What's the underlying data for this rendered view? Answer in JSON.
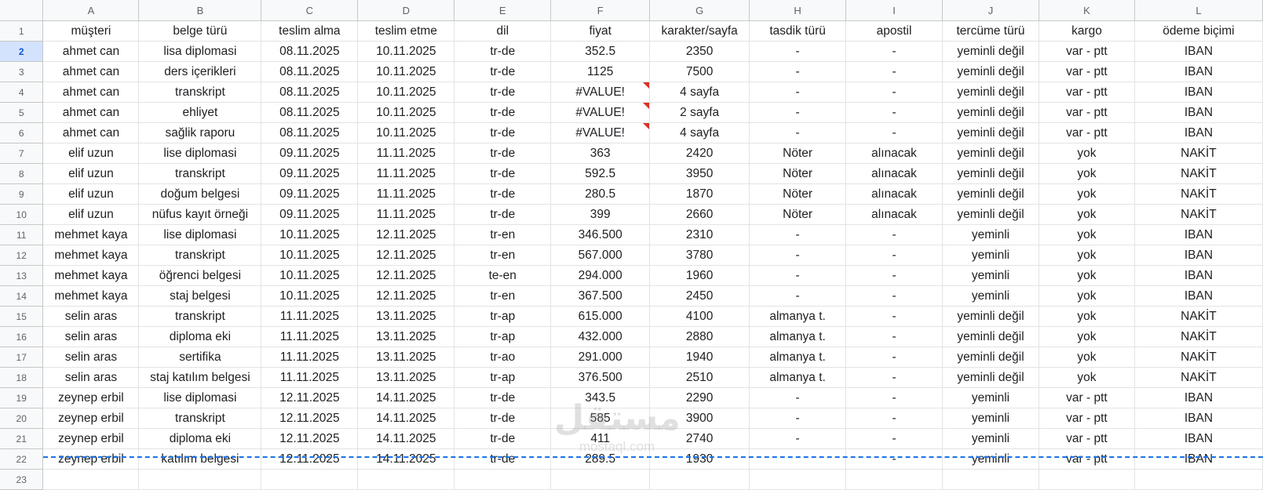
{
  "columns": [
    "A",
    "B",
    "C",
    "D",
    "E",
    "F",
    "G",
    "H",
    "I",
    "J",
    "K",
    "L"
  ],
  "rows": [
    {
      "n": "1",
      "cells": [
        "müşteri",
        "belge türü",
        "teslim alma",
        "teslim etme",
        "dil",
        "fiyat",
        "karakter/sayfa",
        "tasdik türü",
        "apostil",
        "tercüme türü",
        "kargo",
        "ödeme biçimi"
      ]
    },
    {
      "n": "2",
      "cells": [
        "ahmet can",
        "lisa diplomasi",
        "08.11.2025",
        "10.11.2025",
        "tr-de",
        "352.5",
        "2350",
        "-",
        "-",
        "yeminli değil",
        "var - ptt",
        "IBAN"
      ]
    },
    {
      "n": "3",
      "cells": [
        "ahmet can",
        "ders içerikleri",
        "08.11.2025",
        "10.11.2025",
        "tr-de",
        "1125",
        "7500",
        "-",
        "-",
        "yeminli değil",
        "var - ptt",
        "IBAN"
      ]
    },
    {
      "n": "4",
      "cells": [
        "ahmet can",
        "transkript",
        "08.11.2025",
        "10.11.2025",
        "tr-de",
        "#VALUE!",
        "4 sayfa",
        "-",
        "-",
        "yeminli değil",
        "var - ptt",
        "IBAN"
      ]
    },
    {
      "n": "5",
      "cells": [
        "ahmet can",
        "ehliyet",
        "08.11.2025",
        "10.11.2025",
        "tr-de",
        "#VALUE!",
        "2 sayfa",
        "-",
        "-",
        "yeminli değil",
        "var - ptt",
        "IBAN"
      ]
    },
    {
      "n": "6",
      "cells": [
        "ahmet can",
        "sağlik raporu",
        "08.11.2025",
        "10.11.2025",
        "tr-de",
        "#VALUE!",
        "4 sayfa",
        "-",
        "-",
        "yeminli değil",
        "var - ptt",
        "IBAN"
      ]
    },
    {
      "n": "7",
      "cells": [
        "elif uzun",
        "lise diplomasi",
        "09.11.2025",
        "11.11.2025",
        "tr-de",
        "363",
        "2420",
        "Nöter",
        "alınacak",
        "yeminli değil",
        "yok",
        "NAKİT"
      ]
    },
    {
      "n": "8",
      "cells": [
        "elif uzun",
        "transkript",
        "09.11.2025",
        "11.11.2025",
        "tr-de",
        "592.5",
        "3950",
        "Nöter",
        "alınacak",
        "yeminli değil",
        "yok",
        "NAKİT"
      ]
    },
    {
      "n": "9",
      "cells": [
        "elif uzun",
        "doğum belgesi",
        "09.11.2025",
        "11.11.2025",
        "tr-de",
        "280.5",
        "1870",
        "Nöter",
        "alınacak",
        "yeminli değil",
        "yok",
        "NAKİT"
      ]
    },
    {
      "n": "10",
      "cells": [
        "elif uzun",
        "nüfus kayıt örneği",
        "09.11.2025",
        "11.11.2025",
        "tr-de",
        "399",
        "2660",
        "Nöter",
        "alınacak",
        "yeminli değil",
        "yok",
        "NAKİT"
      ]
    },
    {
      "n": "11",
      "cells": [
        "mehmet kaya",
        "lise diplomasi",
        "10.11.2025",
        "12.11.2025",
        "tr-en",
        "346.500",
        "2310",
        "-",
        "-",
        "yeminli",
        "yok",
        "IBAN"
      ]
    },
    {
      "n": "12",
      "cells": [
        "mehmet kaya",
        "transkript",
        "10.11.2025",
        "12.11.2025",
        "tr-en",
        "567.000",
        "3780",
        "-",
        "-",
        "yeminli",
        "yok",
        "IBAN"
      ]
    },
    {
      "n": "13",
      "cells": [
        "mehmet kaya",
        "öğrenci belgesi",
        "10.11.2025",
        "12.11.2025",
        "te-en",
        "294.000",
        "1960",
        "-",
        "-",
        "yeminli",
        "yok",
        "IBAN"
      ]
    },
    {
      "n": "14",
      "cells": [
        "mehmet kaya",
        "staj belgesi",
        "10.11.2025",
        "12.11.2025",
        "tr-en",
        "367.500",
        "2450",
        "-",
        "-",
        "yeminli",
        "yok",
        "IBAN"
      ]
    },
    {
      "n": "15",
      "cells": [
        "selin aras",
        "transkript",
        "11.11.2025",
        "13.11.2025",
        "tr-ap",
        "615.000",
        "4100",
        "almanya t.",
        "-",
        "yeminli değil",
        "yok",
        "NAKİT"
      ]
    },
    {
      "n": "16",
      "cells": [
        "selin aras",
        "diploma eki",
        "11.11.2025",
        "13.11.2025",
        "tr-ap",
        "432.000",
        "2880",
        "almanya t.",
        "-",
        "yeminli değil",
        "yok",
        "NAKİT"
      ]
    },
    {
      "n": "17",
      "cells": [
        "selin aras",
        "sertifika",
        "11.11.2025",
        "13.11.2025",
        "tr-ao",
        "291.000",
        "1940",
        "almanya t.",
        "-",
        "yeminli değil",
        "yok",
        "NAKİT"
      ]
    },
    {
      "n": "18",
      "cells": [
        "selin aras",
        "staj katılım belgesi",
        "11.11.2025",
        "13.11.2025",
        "tr-ap",
        "376.500",
        "2510",
        "almanya t.",
        "-",
        "yeminli değil",
        "yok",
        "NAKİT"
      ]
    },
    {
      "n": "19",
      "cells": [
        "zeynep erbil",
        "lise diplomasi",
        "12.11.2025",
        "14.11.2025",
        "tr-de",
        "343.5",
        "2290",
        "-",
        "-",
        "yeminli",
        "var - ptt",
        "IBAN"
      ]
    },
    {
      "n": "20",
      "cells": [
        "zeynep erbil",
        "transkript",
        "12.11.2025",
        "14.11.2025",
        "tr-de",
        "585",
        "3900",
        "-",
        "-",
        "yeminli",
        "var - ptt",
        "IBAN"
      ]
    },
    {
      "n": "21",
      "cells": [
        "zeynep erbil",
        "diploma eki",
        "12.11.2025",
        "14.11.2025",
        "tr-de",
        "411",
        "2740",
        "-",
        "-",
        "yeminli",
        "var - ptt",
        "IBAN"
      ]
    },
    {
      "n": "22",
      "cells": [
        "zeynep erbil",
        "katılım belgesi",
        "12.11.2025",
        "14.11.2025",
        "tr-de",
        "289.5",
        "1930",
        "",
        "-",
        "yeminli",
        "var - ptt",
        "IBAN"
      ]
    },
    {
      "n": "23",
      "cells": [
        "",
        "",
        "",
        "",
        "",
        "",
        "",
        "",
        "",
        "",
        "",
        ""
      ]
    }
  ],
  "selected_row": "2",
  "error_value": "#VALUE!",
  "watermark": {
    "arabic": "مستقل",
    "latin": "mostaql.com"
  },
  "colors": {
    "error_marker": "#d93025",
    "selection": "#1a73e8",
    "header_bg": "#f8f9fa"
  }
}
